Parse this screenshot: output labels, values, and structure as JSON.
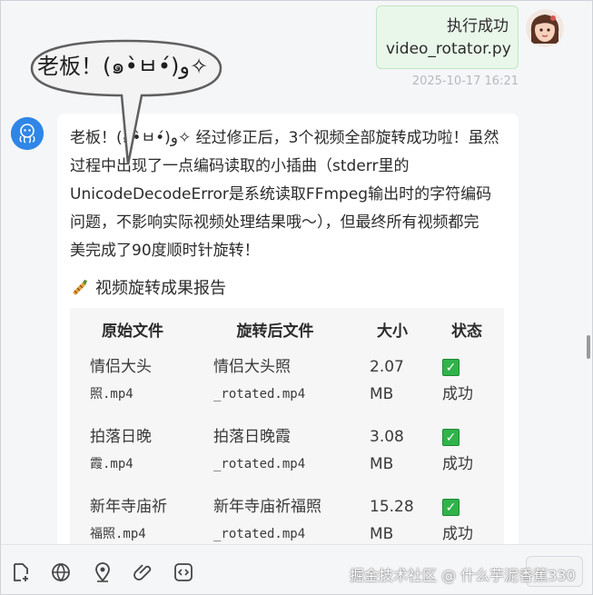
{
  "user_message": {
    "line1": "执行成功",
    "line2": "video_rotator.py",
    "timestamp": "2025-10-17 16:21"
  },
  "speech_bubble": {
    "text": "老板！(๑•̀ㅂ•́)و✧"
  },
  "bot_message": {
    "paragraph_lines": [
      "老板！(๑•̀ㅂ•́)و✧ 经过修正后，3个视频全部旋转成功啦！虽然",
      "过程中出现了一点编码读取的小插曲（stderr里的",
      "UnicodeDecodeError是系统读取FFmpeg输出时的字符编码",
      "问题，不影响实际视频处理结果哦～），但最终所有视频都完",
      "美完成了90度顺时针旋转！"
    ],
    "report_title": "视频旋转成果报告",
    "table": {
      "headers": [
        "原始文件",
        "旋转后文件",
        "大小",
        "状态"
      ],
      "rows": [
        {
          "orig_a": "情侣大头",
          "orig_b": "照.mp4",
          "rot_a": "情侣大头照",
          "rot_b": "_rotated.mp4",
          "size_a": "2.07",
          "size_b": "MB",
          "status": "成功"
        },
        {
          "orig_a": "拍落日晚",
          "orig_b": "霞.mp4",
          "rot_a": "拍落日晚霞",
          "rot_b": "_rotated.mp4",
          "size_a": "3.08",
          "size_b": "MB",
          "status": "成功"
        },
        {
          "orig_a": "新年寺庙祈",
          "orig_b": "福照.mp4",
          "rot_a": "新年寺庙祈福照",
          "rot_b": "_rotated.mp4",
          "size_a": "15.28",
          "size_b": "MB",
          "status": "成功"
        }
      ]
    }
  },
  "toolbar": {
    "icons": [
      "add-file-icon",
      "globe-icon",
      "location-pin-icon",
      "paperclip-icon",
      "code-icon"
    ]
  },
  "watermark": "掘金技术社区 @ 什么芋泥香蕉330",
  "colors": {
    "user_bubble_bg": "#e9f7ea",
    "bot_avatar": "#2f86e6",
    "check_green": "#2fb34a"
  }
}
